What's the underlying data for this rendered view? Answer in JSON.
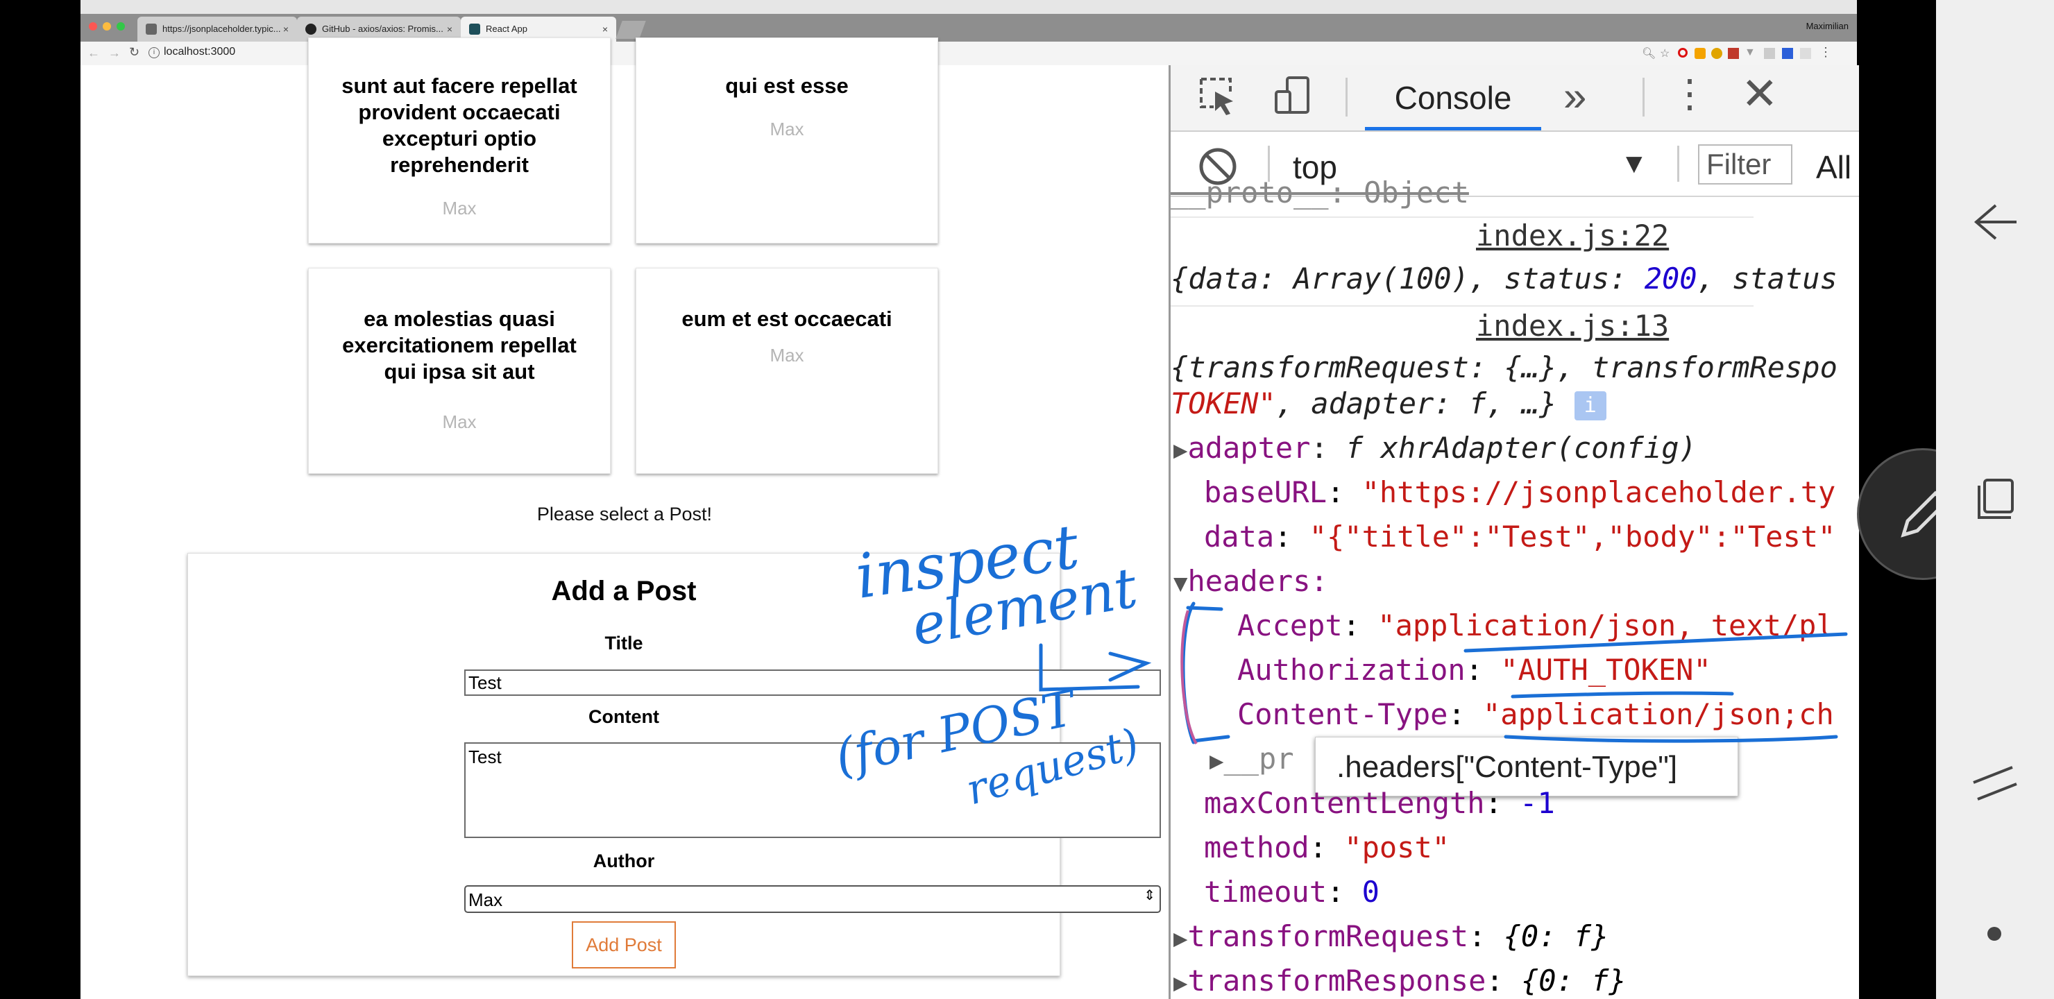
{
  "browser": {
    "tabs": [
      {
        "label": "https://jsonplaceholder.typic..."
      },
      {
        "label": "GitHub - axios/axios: Promis..."
      },
      {
        "label": "React App"
      }
    ],
    "user": "Maximilian",
    "url": "localhost:3000"
  },
  "posts": [
    {
      "title": "sunt aut facere repellat provident occaecati excepturi optio reprehenderit",
      "author": "Max"
    },
    {
      "title": "qui est esse",
      "author": "Max"
    },
    {
      "title": "ea molestias quasi exercitationem repellat qui ipsa sit aut",
      "author": "Max"
    },
    {
      "title": "eum et est occaecati",
      "author": "Max"
    }
  ],
  "select_prompt": "Please select a Post!",
  "new_post": {
    "heading": "Add a Post",
    "title_label": "Title",
    "title_value": "Test",
    "content_label": "Content",
    "content_value": "Test",
    "author_label": "Author",
    "author_value": "Max",
    "submit_label": "Add Post"
  },
  "devtools": {
    "tab_console": "Console",
    "more": "»",
    "context": "top",
    "filter_placeholder": "Filter",
    "levels": "All",
    "tooltip": ".headers[\"Content-Type\"]",
    "lines": {
      "proto_top": "__proto__: Object",
      "src1": "index.js:22",
      "resp": "{data: Array(100), status: 200, status",
      "src2": "index.js:13",
      "cfg1": "{transformRequest: {…}, transformRespo",
      "cfg2_a": "TOKEN\"",
      "cfg2_b": ", adapter: f, …}",
      "adapter_key": "adapter",
      "adapter_val": "f xhrAdapter(config)",
      "baseurl_key": "baseURL",
      "baseurl_val": "\"https://jsonplaceholder.ty",
      "data_key": "data",
      "data_val": "\"{\"title\":\"Test\",\"body\":\"Test\"",
      "headers_key": "headers:",
      "accept_key": "Accept",
      "accept_val": "\"application/json, text/pl",
      "auth_key": "Authorization",
      "auth_val": "\"AUTH_TOKEN\"",
      "ct_key": "Content-Type",
      "ct_val": "\"application/json;ch",
      "proto2": "__pr",
      "maxlen_key": "maxContentLength",
      "maxlen_val": "-1",
      "method_key": "method",
      "method_val": "\"post\"",
      "timeout_key": "timeout",
      "timeout_val": "0",
      "treq_key": "transformRequest",
      "treq_val": "{0: f}",
      "tresp_key": "transformResponse",
      "tresp_val": "{0: f}"
    }
  },
  "annotation": {
    "line1": "inspect",
    "line2": "element",
    "line3": "(for POST",
    "line4": "request)"
  },
  "colors": {
    "ink": "#1a6fd6",
    "add_post": "#e07b39",
    "console_underline": "#1a73e8"
  }
}
